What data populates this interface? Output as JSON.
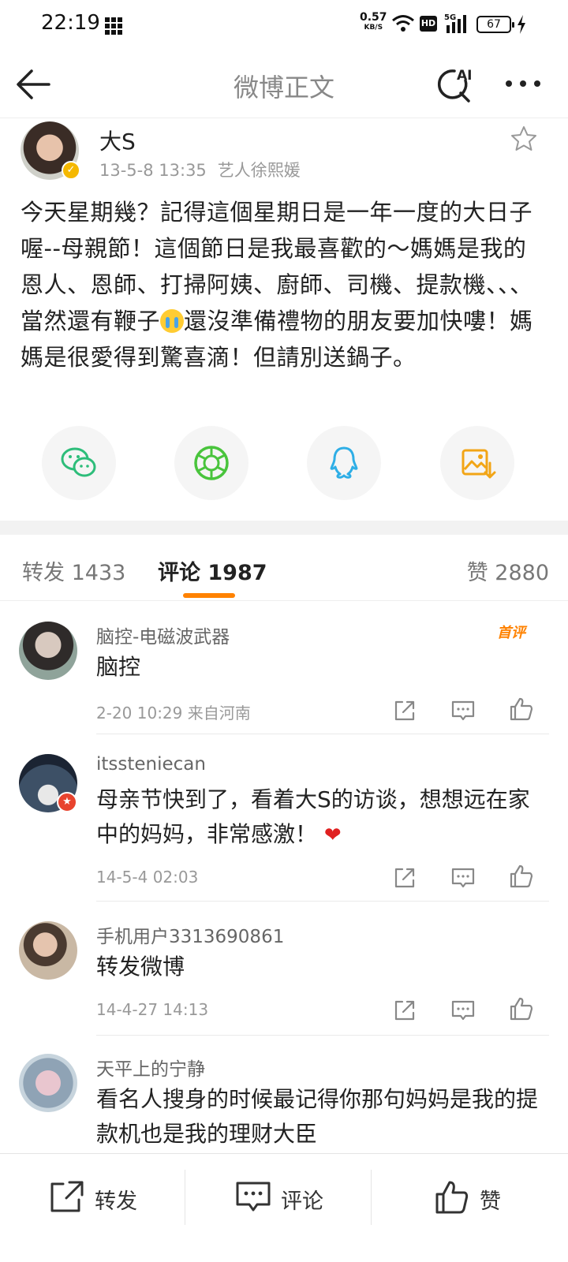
{
  "status_bar": {
    "time": "22:19",
    "net_speed": "0.57",
    "net_unit": "KB/S",
    "hd": "HD",
    "battery": "67"
  },
  "header": {
    "title": "微博正文",
    "ai_label": "AI"
  },
  "post": {
    "author": "大S",
    "date": "13-5-8 13:35",
    "source": "艺人徐熙媛",
    "text_before_emoji": "今天星期幾？記得這個星期日是一年一度的大日子喔--母親節！這個節日是我最喜歡的～媽媽是我的恩人、恩師、打掃阿姨、廚師、司機、提款機、、、當然還有鞭子",
    "text_after_emoji": "還沒準備禮物的朋友要加快嘍！媽媽是很愛得到驚喜滴！但請別送鍋子。"
  },
  "share": {
    "items": [
      "wechat-icon",
      "moments-icon",
      "qq-icon",
      "save-image-icon"
    ],
    "colors": {
      "wechat": "#2dbd7a",
      "moments": "#49c43c",
      "qq": "#2eaee6",
      "image": "#f2a516"
    }
  },
  "tabs": [
    {
      "label": "转发 1433"
    },
    {
      "label": "评论 1987"
    },
    {
      "label": "赞 2880"
    }
  ],
  "accent_color": "#ff8200",
  "comments": [
    {
      "user": "脑控-电磁波武器",
      "text": "脑控",
      "time": "2-20 10:29 来自河南",
      "badge": "首评"
    },
    {
      "user": "itssteniecan",
      "text": "母亲节快到了，看着大S的访谈，想想远在家中的妈妈，非常感激！",
      "time": "14-5-4 02:03"
    },
    {
      "user": "手机用户3313690861",
      "text": "转发微博",
      "time": "14-4-27 14:13"
    },
    {
      "user": "天平上的宁静",
      "text": "看名人搜身的时候最记得你那句妈妈是我的提款机也是我的理财大臣"
    }
  ],
  "bottom_bar": {
    "repost": "转发",
    "comment": "评论",
    "like": "赞"
  }
}
